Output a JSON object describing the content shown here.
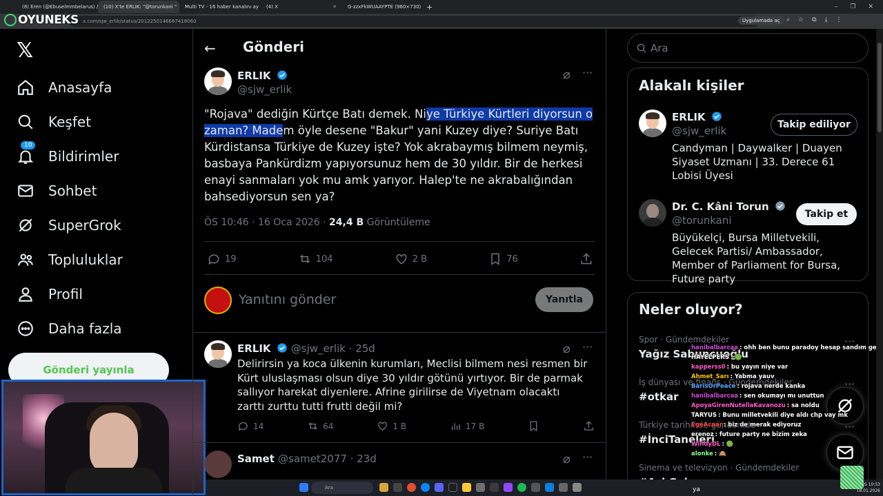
{
  "browser": {
    "tabs": [
      {
        "label": "(8) Eren (@Ebuselmmbelarus) /",
        "active": false
      },
      {
        "label": "(10) X'te ERLIK: \"@torunkani \"",
        "active": true
      },
      {
        "label": "Multi TV - 16 haber kanalını ay",
        "active": false
      },
      {
        "label": "(4) X",
        "active": false
      },
      {
        "label": "G-zzxFkWUAAYPTE (960×730)",
        "active": false
      }
    ],
    "url": "x.com/sjw_erlik/status/2012250146667418060",
    "app_chip": "Uygulamada aç"
  },
  "overlay_brand": "OYUNEKS",
  "nav": {
    "items": [
      {
        "label": "Anasayfa",
        "icon": "home-icon"
      },
      {
        "label": "Keşfet",
        "icon": "search-icon"
      },
      {
        "label": "Bildirimler",
        "icon": "bell-icon",
        "badge": "10"
      },
      {
        "label": "Sohbet",
        "icon": "mail-icon"
      },
      {
        "label": "SuperGrok",
        "icon": "grok-icon"
      },
      {
        "label": "Topluluklar",
        "icon": "people-icon"
      },
      {
        "label": "Profil",
        "icon": "person-icon"
      },
      {
        "label": "Daha fazla",
        "icon": "more-circle-icon"
      }
    ],
    "post_button": "Gönderi yayınla"
  },
  "main": {
    "title": "Gönderi",
    "tweet": {
      "name": "ERLIK",
      "handle": "@sjw_erlik",
      "text_before": "\"Rojava\" dediğin Kürtçe Batı demek. Ni",
      "text_highlight": "ye Türkiye Kürtleri diyorsun o zaman? Made",
      "text_after": "m öyle desene \"Bakur\" yani Kuzey diye? Suriye Batı Kürdistansa Türkiye de Kuzey işte? Yok akrabaymış bilmem neymiş, basbaya Pankürdizm yapıyorsunuz hem de 30 yıldır. Bir de herkesi enayi sanmaları yok mu amk yarıyor. Halep'te ne akrabalığından bahsediyorsun sen ya?",
      "time": "ÖS 10:46 · 16 Oca 2026 · ",
      "views": "24,4 B",
      "views_label": " Görüntüleme",
      "replies": "19",
      "retweets": "104",
      "likes": "2 B",
      "bookmarks": "76"
    },
    "reply_placeholder": "Yanıtını gönder",
    "reply_button": "Yanıtla",
    "replies": [
      {
        "name": "ERLIK",
        "handle": "@sjw_erlik · 25d",
        "text": "Delirirsin ya koca ülkenin kurumları, Meclisi bilmem nesi resmen bir Kürt uluslaşması olsun diye 30 yıldır götünü yırtıyor. Bir de parmak sallıyor harekat diyenlere. Afrine girilirse de Viyetnam olacaktı zarttı zurttu tutti frutti değil mi?",
        "replies": "14",
        "retweets": "64",
        "likes": "1 B",
        "views": "17 B"
      },
      {
        "name": "Samet",
        "handle": "@samet2077 · 23d"
      }
    ]
  },
  "right": {
    "search_placeholder": "Ara",
    "related_title": "Alakalı kişiler",
    "people": [
      {
        "name": "ERLIK",
        "handle": "@sjw_erlik",
        "button": "Takip ediliyor",
        "bio": "Candyman | Daywalker | Duayen Siyaset Uzmanı | 33. Derece 61 Lobisi Üyesi"
      },
      {
        "name": "Dr. C. Kâni Torun",
        "handle": "@torunkani",
        "button": "Takip et",
        "bio": "Büyükelçi, Bursa Milletvekili, Gelecek Partisi/ Ambassador, Member of Parliament for Bursa, Future party"
      }
    ],
    "trends_title": "Neler oluyor?",
    "trends": [
      {
        "category": "Spor · Gündemdekiler",
        "name": "Yağız Sabuncuoğlu"
      },
      {
        "category": "İş dünyası ve finans · Gündemdekiler",
        "name": "#otkar"
      },
      {
        "category": "Türkiye tarihinde gündemde",
        "name": "#İnciTaneleri"
      },
      {
        "category": "Sinema ve televizyon · Gündemdekiler",
        "name": "#AskGelo"
      }
    ]
  },
  "chat": [
    {
      "user": "hanibalbarcaa",
      "color": "#d04ad6",
      "msg": ": ohh ben bunu paradoy hesap sandım gerçekmiş"
    },
    {
      "user": "HAYELPERS",
      "color": "#ffffff",
      "msg": ": 🟢"
    },
    {
      "user": "kapperss0",
      "color": "#ff5ad0",
      "msg": ": bu yayın niye var"
    },
    {
      "user": "Ahmet_Sarı",
      "color": "#ffc400",
      "msg": ": Yabma yauv"
    },
    {
      "user": "BarisOrPeace",
      "color": "#5aa8ff",
      "msg": ": rojava nerde kanka"
    },
    {
      "user": "hanibalbarcaa",
      "color": "#d04ad6",
      "msg": ": sen okumayı mı unuttun"
    },
    {
      "user": "ApoyaGirenNutellaKavanozu",
      "color": "#ff5ad0",
      "msg": ": sa noldu"
    },
    {
      "user": "TARYUS",
      "color": "#ffffff",
      "msg": ": Bunu milletvekili diye aldı chp vay mk"
    },
    {
      "user": "EgeAcaar",
      "color": "#ff4d4d",
      "msg": ": biz de merak ediyoruz"
    },
    {
      "user": "erenoz",
      "color": "#ffffff",
      "msg": ": future party ne bizim zeka"
    },
    {
      "user": "WindyDL",
      "color": "#ff5ad0",
      "msg": ": 🟢"
    },
    {
      "user": "alonke",
      "color": "#8aff8a",
      "msg": ": 🙈"
    }
  ],
  "chat_input": "ya",
  "taskbar": {
    "search": "Ara",
    "time": "ÖS 10:53",
    "date": "18.01.2026"
  }
}
